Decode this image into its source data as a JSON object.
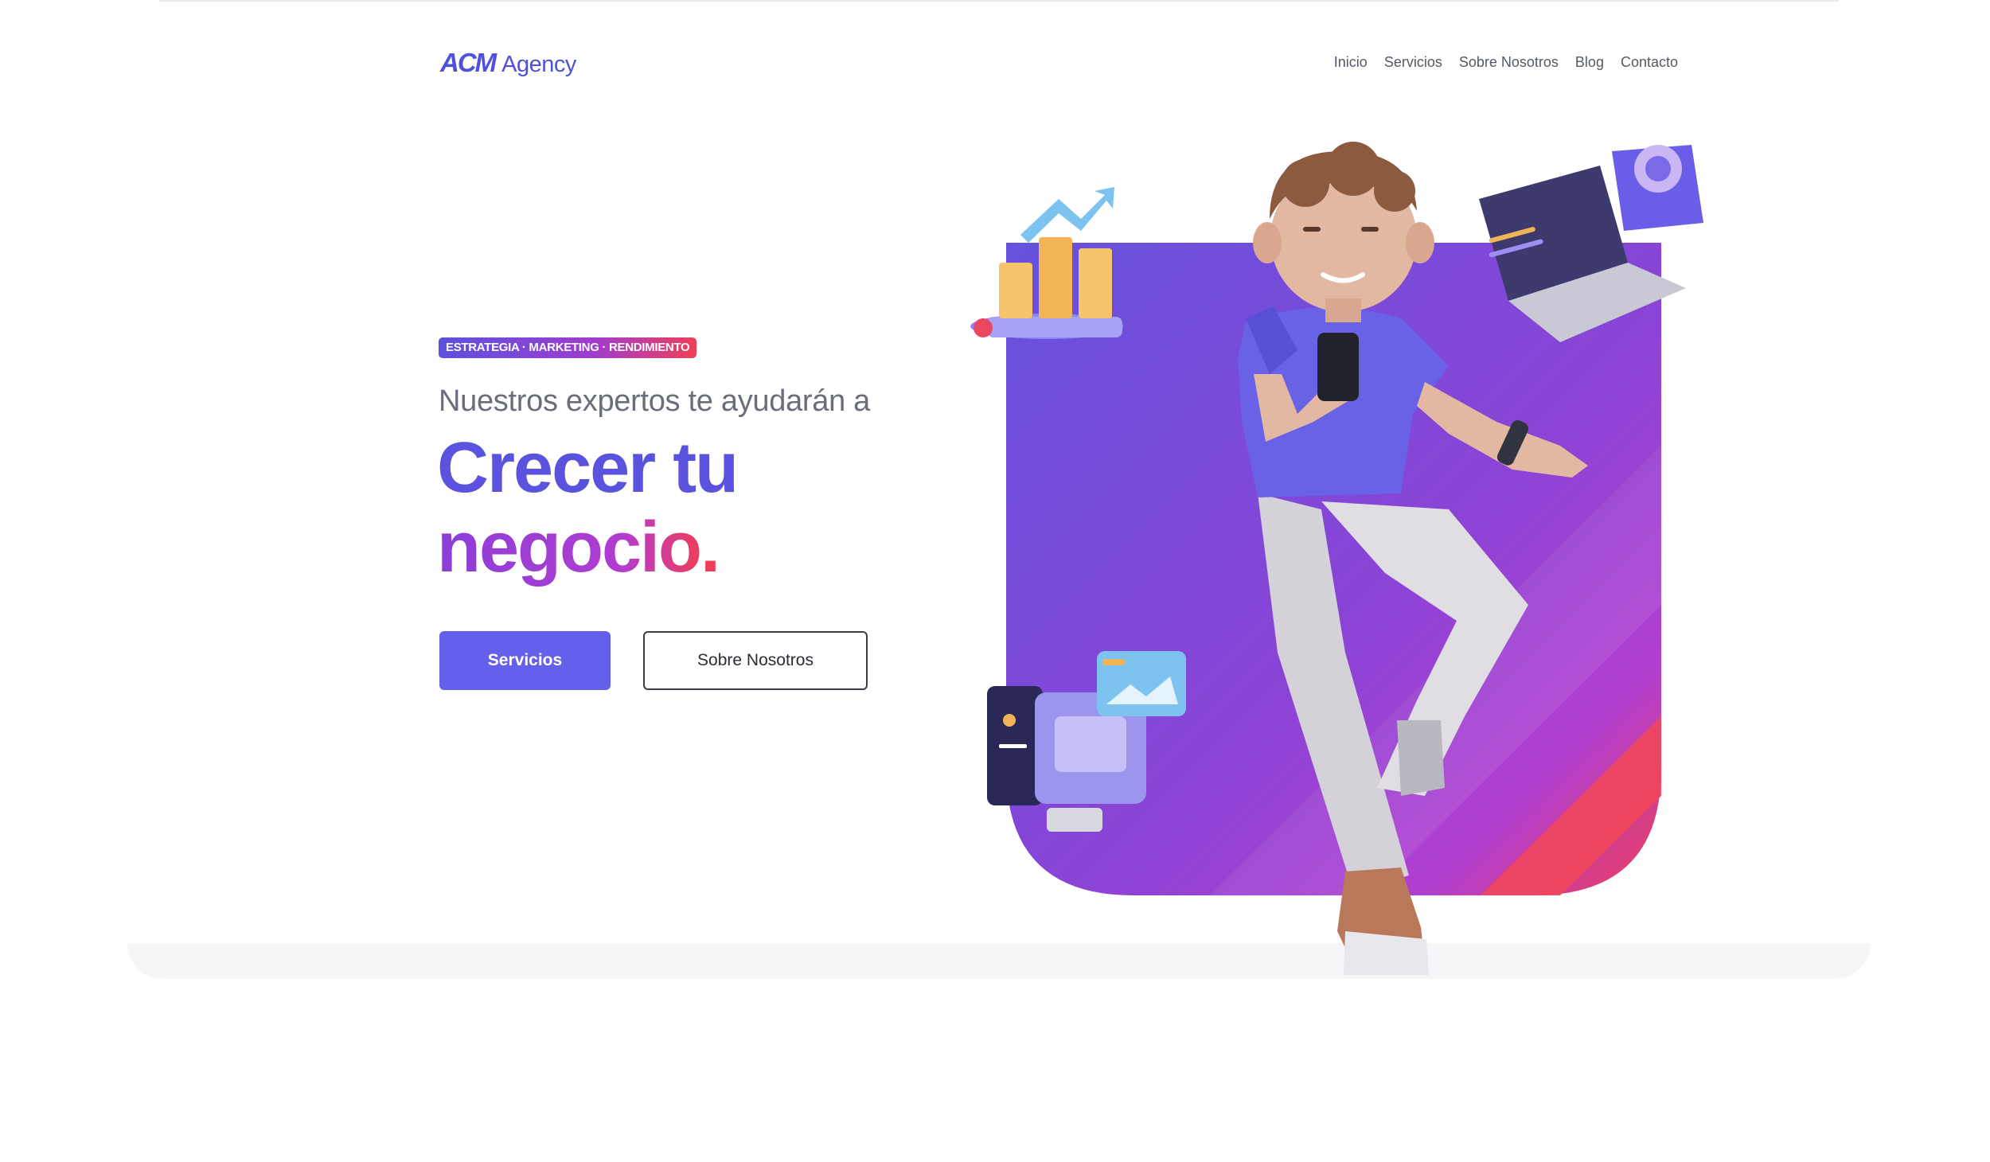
{
  "header": {
    "logo_mark": "ACM",
    "logo_text": "Agency",
    "nav": [
      "Inicio",
      "Servicios",
      "Sobre Nosotros",
      "Blog",
      "Contacto"
    ]
  },
  "hero": {
    "badge": "ESTRATEGIA · MARKETING · RENDIMIENTO",
    "subtitle": "Nuestros expertos te ayudarán a",
    "headline_line1": "Crecer tu",
    "headline_line2": "negocio",
    "headline_dot": ".",
    "primary_button": "Servicios",
    "secondary_button": "Sobre Nosotros"
  },
  "colors": {
    "brand": "#5b52de",
    "accent": "#ef3f58",
    "button": "#6560ec"
  },
  "illustration": {
    "icons": [
      "bar-chart-icon",
      "trend-arrow-icon",
      "laptop-icon",
      "camera-icon",
      "desktop-monitor-icon",
      "image-card-icon",
      "smartphone-icon"
    ]
  }
}
